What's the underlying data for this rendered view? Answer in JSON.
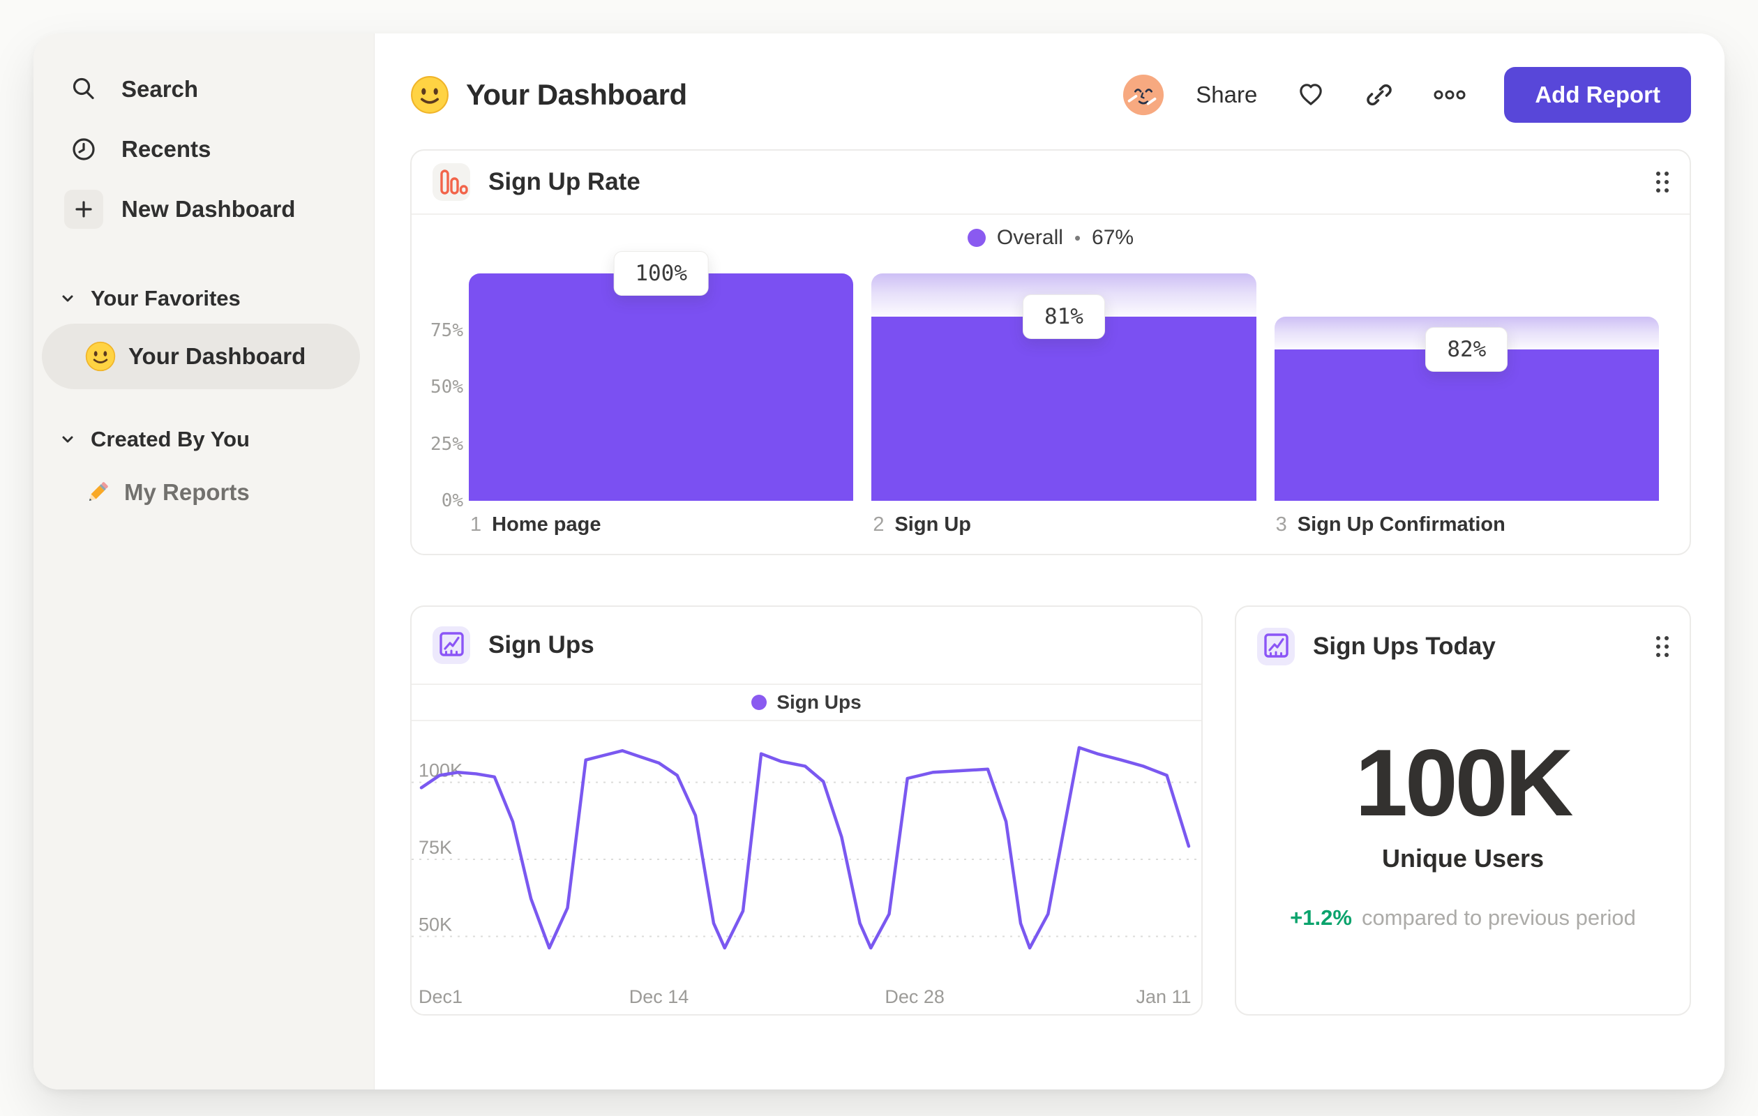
{
  "theme": {
    "accent": "#5847D9",
    "bar_purple": "#7B50F2",
    "dot_purple": "#8A5AF0",
    "line_purple": "#7A58F0",
    "orange": "#F2644A",
    "green": "#0AA36C",
    "sidebar_bg": "#F5F4F1"
  },
  "sidebar": {
    "nav": [
      {
        "label": "Search",
        "icon": "search-icon"
      },
      {
        "label": "Recents",
        "icon": "clock-icon"
      },
      {
        "label": "New Dashboard",
        "icon": "plus-icon"
      }
    ],
    "favorites_header": "Your Favorites",
    "favorites": [
      {
        "label": "Your Dashboard",
        "emoji": "slightly-smiling-face",
        "active": true
      }
    ],
    "created_header": "Created By You",
    "created": [
      {
        "label": "My Reports",
        "emoji": "pencil",
        "active": false
      }
    ]
  },
  "header": {
    "title": "Your Dashboard",
    "title_emoji": "slightly-smiling-face",
    "share": "Share",
    "add_report": "Add Report"
  },
  "funnel_card": {
    "title": "Sign Up Rate",
    "legend_label": "Overall",
    "legend_sep": "•",
    "legend_value": "67%"
  },
  "line_card": {
    "title": "Sign Ups",
    "legend_label": "Sign Ups"
  },
  "today_card": {
    "title": "Sign Ups Today",
    "metric": "100K",
    "metric_label": "Unique Users",
    "delta": "+1.2%",
    "delta_desc": "compared to previous period"
  },
  "chart_data": [
    {
      "type": "bar",
      "subtype": "funnel",
      "title": "Sign Up Rate",
      "legend": {
        "label": "Overall",
        "value_pct": 67
      },
      "ylim": [
        0,
        100
      ],
      "y_ticks": [
        {
          "label": "75%",
          "pct": 75
        },
        {
          "label": "50%",
          "pct": 50
        },
        {
          "label": "25%",
          "pct": 25
        },
        {
          "label": "0%",
          "pct": 0
        }
      ],
      "grid": false,
      "steps": [
        {
          "index": "1",
          "label": "Home page",
          "start_pct": 100,
          "conversion_pct": 100,
          "value_label": "100%"
        },
        {
          "index": "2",
          "label": "Sign Up",
          "start_pct": 100,
          "conversion_pct": 81,
          "value_label": "81%"
        },
        {
          "index": "3",
          "label": "Sign Up Confirmation",
          "start_pct": 81,
          "conversion_pct": 82,
          "value_label": "82%"
        }
      ]
    },
    {
      "type": "line",
      "title": "Sign Ups",
      "series_name": "Sign Ups",
      "unit": "K",
      "legend_position": "top-center",
      "grid": "dashed-horizontal",
      "ylim": [
        40,
        112
      ],
      "xlim_days": [
        0,
        42
      ],
      "y_ticks": [
        {
          "label": "100K",
          "value": 100
        },
        {
          "label": "75K",
          "value": 75
        },
        {
          "label": "50K",
          "value": 50
        }
      ],
      "x_ticks": [
        {
          "label": "Dec1",
          "day": 0
        },
        {
          "label": "Dec 14",
          "day": 13
        },
        {
          "label": "Dec 28",
          "day": 27
        },
        {
          "label": "Jan 11",
          "day": 41
        }
      ],
      "points": [
        [
          0,
          96
        ],
        [
          1,
          100
        ],
        [
          2,
          101
        ],
        [
          3,
          100.5
        ],
        [
          4,
          99.5
        ],
        [
          5,
          85
        ],
        [
          6,
          60
        ],
        [
          7,
          44
        ],
        [
          8,
          57
        ],
        [
          9,
          105
        ],
        [
          10,
          106.5
        ],
        [
          11,
          108
        ],
        [
          12,
          106
        ],
        [
          13,
          104
        ],
        [
          14,
          100
        ],
        [
          15,
          87
        ],
        [
          16,
          52
        ],
        [
          16.6,
          44
        ],
        [
          17.6,
          56
        ],
        [
          18.6,
          107
        ],
        [
          19.7,
          104.5
        ],
        [
          21,
          103
        ],
        [
          22,
          98
        ],
        [
          23,
          80
        ],
        [
          24,
          52
        ],
        [
          24.6,
          44
        ],
        [
          25.6,
          55
        ],
        [
          26.6,
          99
        ],
        [
          28,
          101
        ],
        [
          29.5,
          101.5
        ],
        [
          31,
          102
        ],
        [
          32,
          85
        ],
        [
          32.8,
          52
        ],
        [
          33.3,
          44
        ],
        [
          34.3,
          55
        ],
        [
          36,
          109
        ],
        [
          37,
          107
        ],
        [
          38.3,
          105
        ],
        [
          39.5,
          103
        ],
        [
          40.8,
          100
        ],
        [
          42,
          77
        ]
      ]
    }
  ]
}
